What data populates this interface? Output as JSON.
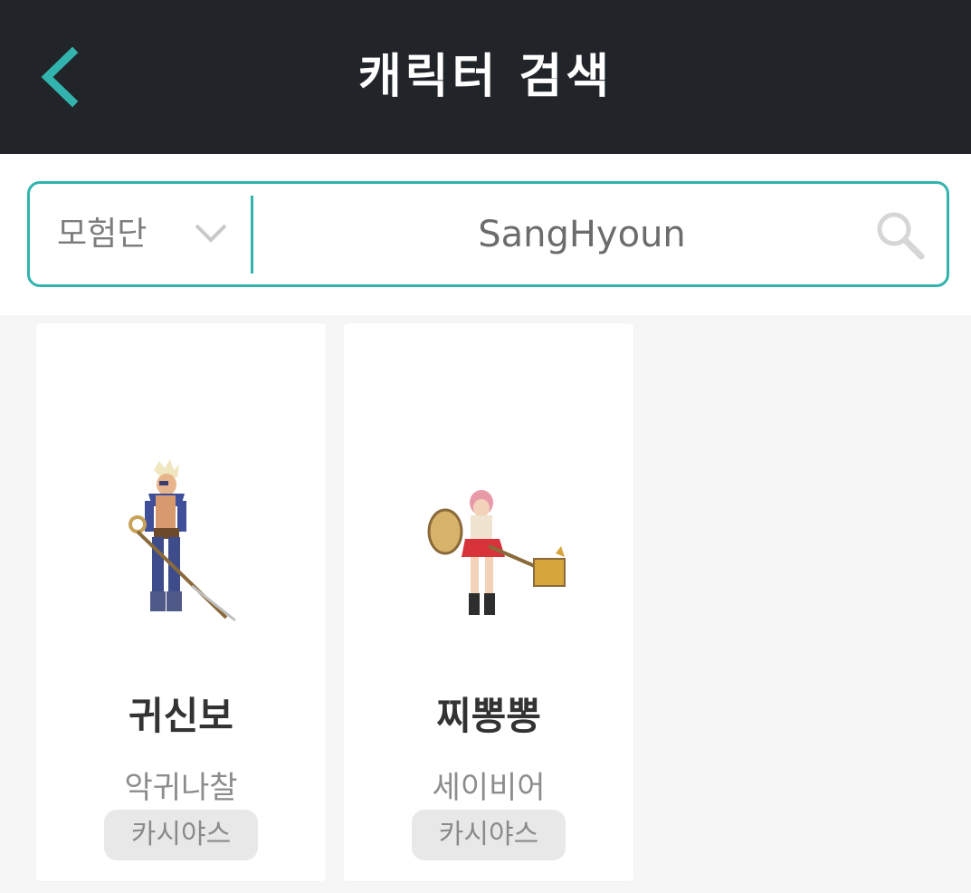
{
  "header": {
    "title": "캐릭터 검색",
    "back_icon": "chevron-left-icon"
  },
  "search": {
    "category_selected": "모험단",
    "query_value": "SangHyoun",
    "accent_color": "#33b3ad",
    "search_icon": "search-icon"
  },
  "results": [
    {
      "name": "귀신보",
      "job": "악귀나찰",
      "server": "카시야스",
      "avatar_icon": "character-sprite-swordsman-icon"
    },
    {
      "name": "찌뽕뽕",
      "job": "세이비어",
      "server": "카시야스",
      "avatar_icon": "character-sprite-hammer-knight-icon"
    }
  ]
}
